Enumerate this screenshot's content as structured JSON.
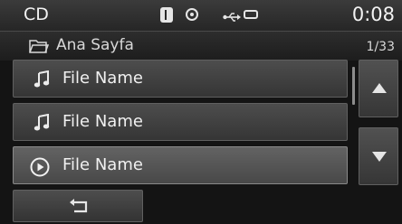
{
  "status": {
    "mode": "CD",
    "clock": "0:08",
    "icons": [
      "bluetooth-icon",
      "disc-icon",
      "usb-icon",
      "plug-icon"
    ]
  },
  "path": {
    "folder_label": "Ana Sayfa",
    "count": "1/33"
  },
  "list": {
    "items": [
      {
        "label": "File Name",
        "icon": "music-note-icon",
        "selected": false
      },
      {
        "label": "File Name",
        "icon": "music-note-icon",
        "selected": false
      },
      {
        "label": "File Name",
        "icon": "play-circle-icon",
        "selected": true
      }
    ]
  },
  "controls": {
    "scroll_up_icon": "arrow-up-icon",
    "scroll_down_icon": "arrow-down-icon",
    "back_icon": "return-arrow-icon"
  },
  "colors": {
    "background": "#141414",
    "row": "#3f3f3f",
    "row_selected": "#555555",
    "text": "#f0f0f0"
  }
}
